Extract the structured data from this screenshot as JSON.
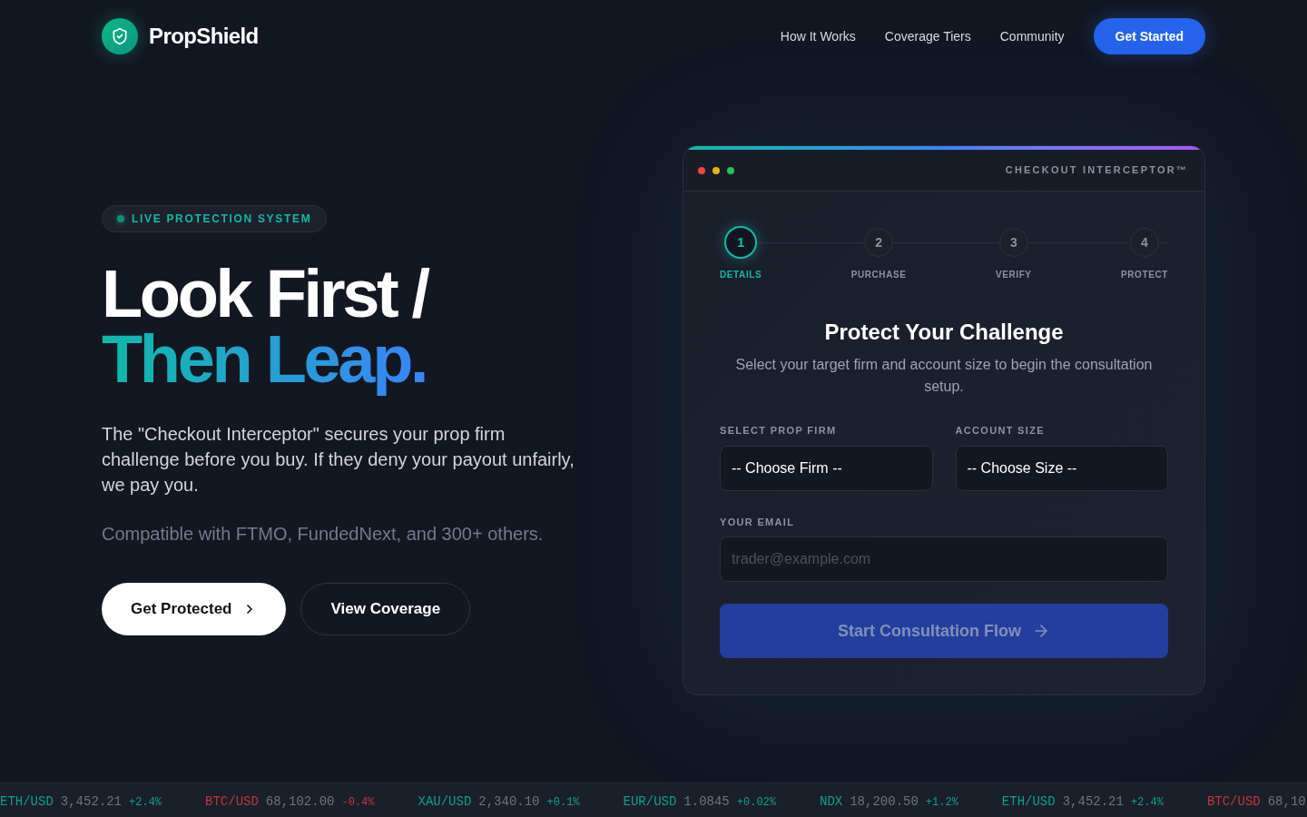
{
  "nav": {
    "brand": "PropShield",
    "links": [
      "How It Works",
      "Coverage Tiers",
      "Community"
    ],
    "cta": "Get Started"
  },
  "hero": {
    "badge": "LIVE PROTECTION SYSTEM",
    "headline": {
      "line_1": "Look First /",
      "line_2": "Then Leap."
    },
    "description": "The \"Checkout Interceptor\" secures your prop firm challenge before you buy. If they deny your payout unfairly, we pay you.",
    "compatibility": "Compatible with FTMO, FundedNext, and 300+ others.",
    "buttons": [
      {
        "label": "Get Protected",
        "kind": "primary"
      },
      {
        "label": "View Coverage",
        "kind": "secondary"
      }
    ]
  },
  "checkout_card": {
    "title": "CHECKOUT INTERCEPTOR™",
    "steps": [
      {
        "number": "1",
        "label": "DETAILS",
        "current": true
      },
      {
        "number": "2",
        "label": "PURCHASE",
        "current": false
      },
      {
        "number": "3",
        "label": "VERIFY",
        "current": false
      },
      {
        "number": "4",
        "label": "PROTECT",
        "current": false
      }
    ],
    "heading": "Protect Your Challenge",
    "subheading": "Select your target firm and account size to begin the consultation setup.",
    "fields": [
      {
        "kind": "select",
        "label": "SELECT PROP FIRM",
        "value": "-- Choose Firm --"
      },
      {
        "kind": "select",
        "label": "ACCOUNT SIZE",
        "value": "-- Choose Size --"
      },
      {
        "kind": "input",
        "label": "YOUR EMAIL",
        "placeholder": "trader@example.com"
      }
    ],
    "submit": {
      "label": "Start Consultation Flow",
      "disabled": true
    }
  },
  "ticker": [
    {
      "symbol": "ETH/USD",
      "price": "3,452.21",
      "change": "+2.4%",
      "color": "#11a08d"
    },
    {
      "symbol": "BTC/USD",
      "price": "68,102.00",
      "change": "-0.4%",
      "color": "#bd3a3c"
    },
    {
      "symbol": "XAU/USD",
      "price": "2,340.10",
      "change": "+0.1%",
      "color": "#11a08d"
    },
    {
      "symbol": "EUR/USD",
      "price": "1.0845",
      "change": "+0.02%",
      "color": "#11a08d"
    },
    {
      "symbol": "NDX",
      "price": "18,200.50",
      "change": "+1.2%",
      "color": "#11a08d"
    },
    {
      "symbol": "ETH/USD",
      "price": "3,452.21",
      "change": "+2.4%",
      "color": "#11a08d"
    },
    {
      "symbol": "BTC/USD",
      "price": "68,10",
      "color": "#bd3a3c"
    }
  ]
}
